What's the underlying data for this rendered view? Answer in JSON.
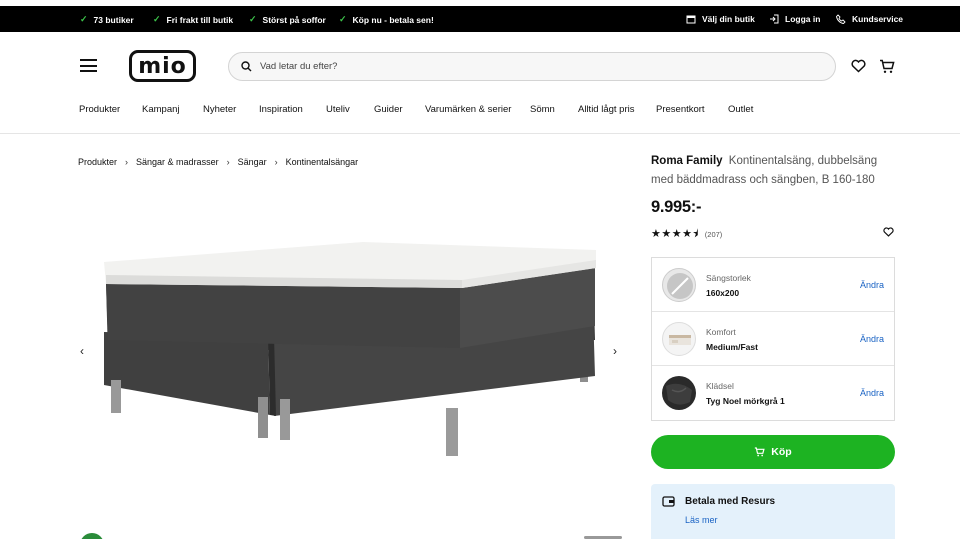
{
  "promo": {
    "items": [
      "73 butiker",
      "Fri frakt till butik",
      "Störst på soffor",
      "Köp nu - betala sen!"
    ],
    "right": [
      "Välj din butik",
      "Logga in",
      "Kundservice"
    ]
  },
  "header": {
    "logo": "mio",
    "search_placeholder": "Vad letar du efter?"
  },
  "nav": [
    "Produkter",
    "Kampanj",
    "Nyheter",
    "Inspiration",
    "Uteliv",
    "Guider",
    "Varumärken & serier",
    "Sömn",
    "Alltid lågt pris",
    "Presentkort",
    "Outlet"
  ],
  "breadcrumb": [
    "Produkter",
    "Sängar & madrasser",
    "Sängar",
    "Kontinentalsängar"
  ],
  "product": {
    "brand": "Roma Family",
    "description": "Kontinentalsäng, dubbelsäng med bäddmadrass och sängben, B 160-180",
    "price": "9.995:-",
    "stars": "★★★★⯨",
    "rating": 4.5,
    "review_count": "(207)"
  },
  "options": [
    {
      "label": "Sängstorlek",
      "value": "160x200",
      "action": "Ändra"
    },
    {
      "label": "Komfort",
      "value": "Medium/Fast",
      "action": "Ändra"
    },
    {
      "label": "Klädsel",
      "value": "Tyg Noel mörkgrå 1",
      "action": "Ändra"
    }
  ],
  "buy_label": "Köp",
  "payment": {
    "title": "Betala med Resurs",
    "link": "Läs mer"
  },
  "colors": {
    "buy": "#1db322",
    "link": "#1a63c4",
    "promo_bg": "#000000",
    "resurs_bg": "#e4f1fb"
  }
}
